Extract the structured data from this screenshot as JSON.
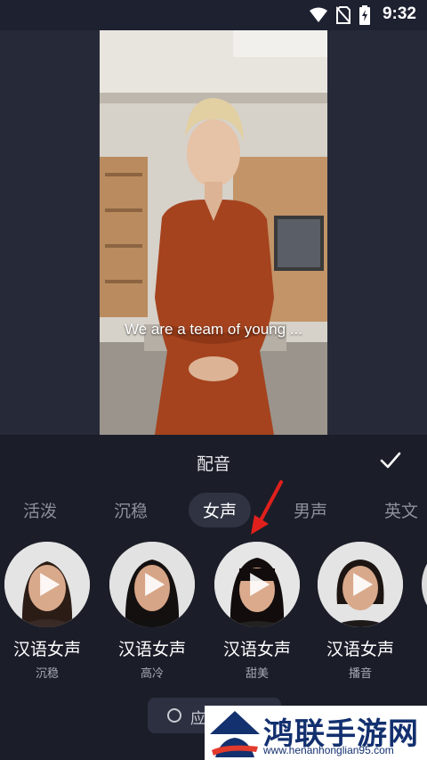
{
  "status": {
    "time": "9:32"
  },
  "preview": {
    "subtitle": "We are a team of young ..."
  },
  "panel": {
    "title": "配音",
    "tabs": [
      "活泼",
      "沉稳",
      "女声",
      "男声",
      "英文"
    ],
    "active_tab": "女声",
    "voices": [
      {
        "name": "汉语女声",
        "desc": "沉稳"
      },
      {
        "name": "汉语女声",
        "desc": "高冷"
      },
      {
        "name": "汉语女声",
        "desc": "甜美"
      },
      {
        "name": "汉语女声",
        "desc": "播音"
      }
    ],
    "apply_label": "应"
  },
  "watermark": {
    "text": "鸿联手游网",
    "url": "www.henanhonglian95.com"
  },
  "colors": {
    "background": "#1b1e29",
    "active_tab_bg": "#2f3342",
    "arrow": "#e0201c",
    "watermark_text": "#13306f"
  }
}
